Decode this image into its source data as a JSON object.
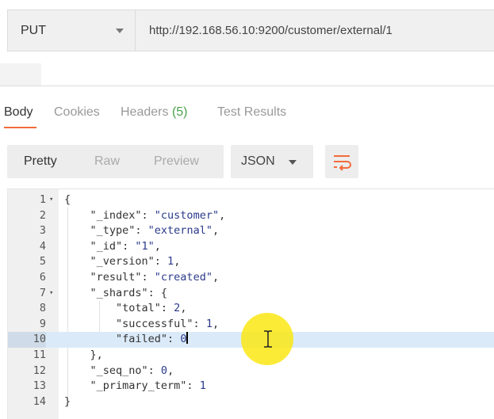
{
  "request": {
    "method": "PUT",
    "url": "http://192.168.56.10:9200/customer/external/1"
  },
  "response_tabs": {
    "body": "Body",
    "cookies": "Cookies",
    "headers": "Headers",
    "headers_count": "(5)",
    "test_results": "Test Results",
    "active": "Body"
  },
  "view_modes": {
    "pretty": "Pretty",
    "raw": "Raw",
    "preview": "Preview",
    "active": "Pretty"
  },
  "format": {
    "selected": "JSON"
  },
  "icons": {
    "method_caret": "chevron-down-icon",
    "format_caret": "chevron-down-icon",
    "wrap": "wrap-lines-icon",
    "fold": "fold-arrow-icon",
    "pointer": "text-cursor-icon"
  },
  "colors": {
    "accent": "#f26b3a",
    "headers_count": "#4aa14a",
    "current_line": "#dbeaf8",
    "pointer_highlight": "#fae814"
  },
  "editor": {
    "current_line": 10,
    "lines": [
      {
        "n": "1",
        "fold": true,
        "segments": [
          "{"
        ]
      },
      {
        "n": "2",
        "segments": [
          "    \"_index\": ",
          "\"customer\"",
          ","
        ]
      },
      {
        "n": "3",
        "segments": [
          "    \"_type\": ",
          "\"external\"",
          ","
        ]
      },
      {
        "n": "4",
        "segments": [
          "    \"_id\": ",
          "\"1\"",
          ","
        ]
      },
      {
        "n": "5",
        "segments": [
          "    \"_version\": ",
          "1",
          ","
        ]
      },
      {
        "n": "6",
        "segments": [
          "    \"result\": ",
          "\"created\"",
          ","
        ]
      },
      {
        "n": "7",
        "fold": true,
        "segments": [
          "    \"_shards\": {"
        ]
      },
      {
        "n": "8",
        "segments": [
          "        \"total\": ",
          "2",
          ","
        ]
      },
      {
        "n": "9",
        "segments": [
          "        \"successful\": ",
          "1",
          ","
        ]
      },
      {
        "n": "10",
        "segments": [
          "        \"failed\": ",
          "0",
          ""
        ]
      },
      {
        "n": "11",
        "segments": [
          "    },"
        ]
      },
      {
        "n": "12",
        "segments": [
          "    \"_seq_no\": ",
          "0",
          ","
        ]
      },
      {
        "n": "13",
        "segments": [
          "    \"_primary_term\": ",
          "1",
          ""
        ]
      },
      {
        "n": "14",
        "segments": [
          "}"
        ]
      }
    ]
  }
}
